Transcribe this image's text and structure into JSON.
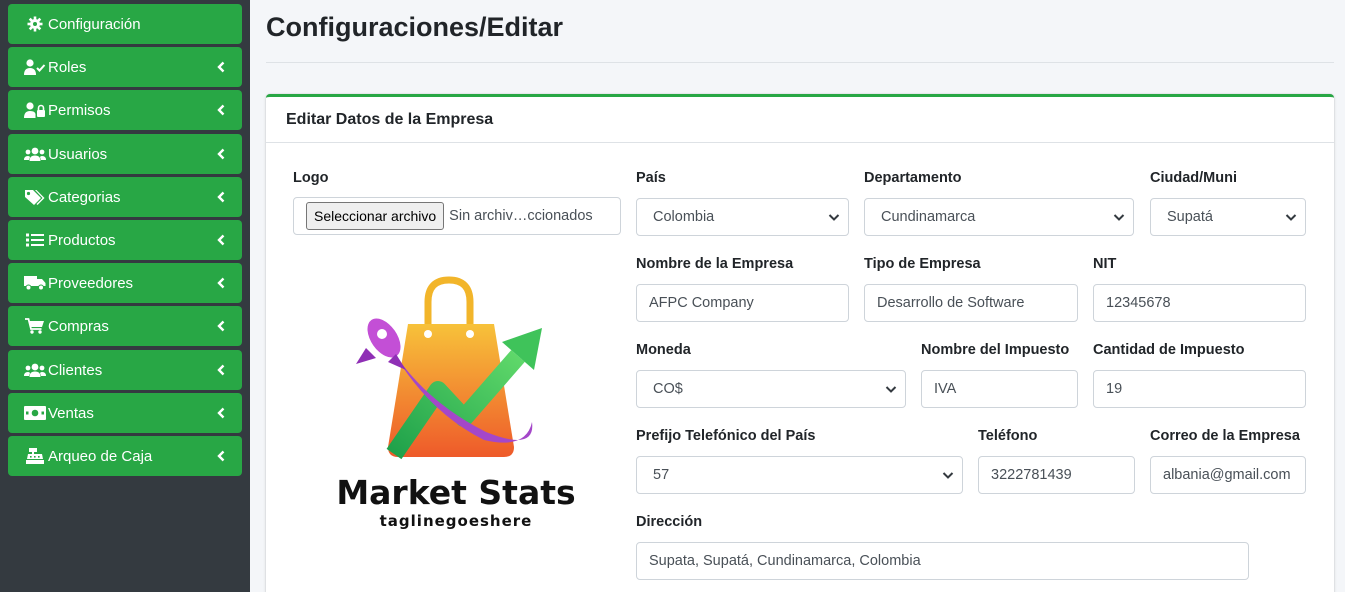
{
  "sidebar": {
    "items": [
      {
        "label": "Configuración",
        "icon": "gear-icon"
      },
      {
        "label": "Roles",
        "icon": "user-check-icon"
      },
      {
        "label": "Permisos",
        "icon": "user-lock-icon"
      },
      {
        "label": "Usuarios",
        "icon": "users-icon"
      },
      {
        "label": "Categorias",
        "icon": "tags-icon"
      },
      {
        "label": "Productos",
        "icon": "list-icon"
      },
      {
        "label": "Proveedores",
        "icon": "truck-icon"
      },
      {
        "label": "Compras",
        "icon": "cart-icon"
      },
      {
        "label": "Clientes",
        "icon": "users-icon"
      },
      {
        "label": "Ventas",
        "icon": "money-icon"
      },
      {
        "label": "Arqueo de Caja",
        "icon": "cash-register-icon"
      }
    ]
  },
  "page": {
    "title": "Configuraciones/Editar"
  },
  "card": {
    "title": "Editar Datos de la Empresa"
  },
  "form": {
    "logo": {
      "label": "Logo",
      "button": "Seleccionar archivo",
      "status": "Sin archiv…ccionados"
    },
    "logo_image": {
      "name": "Market Stats",
      "tagline": "taglinegoeshere"
    },
    "pais": {
      "label": "País",
      "value": "Colombia"
    },
    "departamento": {
      "label": "Departamento",
      "value": "Cundinamarca"
    },
    "ciudad": {
      "label": "Ciudad/Muni",
      "value": "Supatá"
    },
    "nombre_empresa": {
      "label": "Nombre de la Empresa",
      "value": "AFPC Company"
    },
    "tipo_empresa": {
      "label": "Tipo de Empresa",
      "value": "Desarrollo de Software"
    },
    "nit": {
      "label": "NIT",
      "value": "12345678"
    },
    "moneda": {
      "label": "Moneda",
      "value": "CO$"
    },
    "nombre_impuesto": {
      "label": "Nombre del Impuesto",
      "value": "IVA"
    },
    "cantidad_impuesto": {
      "label": "Cantidad de Impuesto",
      "value": "19"
    },
    "prefijo": {
      "label": "Prefijo Telefónico del País",
      "value": "57"
    },
    "telefono": {
      "label": "Teléfono",
      "value": "3222781439"
    },
    "correo": {
      "label": "Correo de la Empresa",
      "value": "albania@gmail.com"
    },
    "direccion": {
      "label": "Dirección",
      "value": "Supata, Supatá, Cundinamarca, Colombia"
    }
  },
  "colors": {
    "accent": "#28a745",
    "sidebar_bg": "#343a40",
    "page_bg": "#f4f6f9"
  }
}
